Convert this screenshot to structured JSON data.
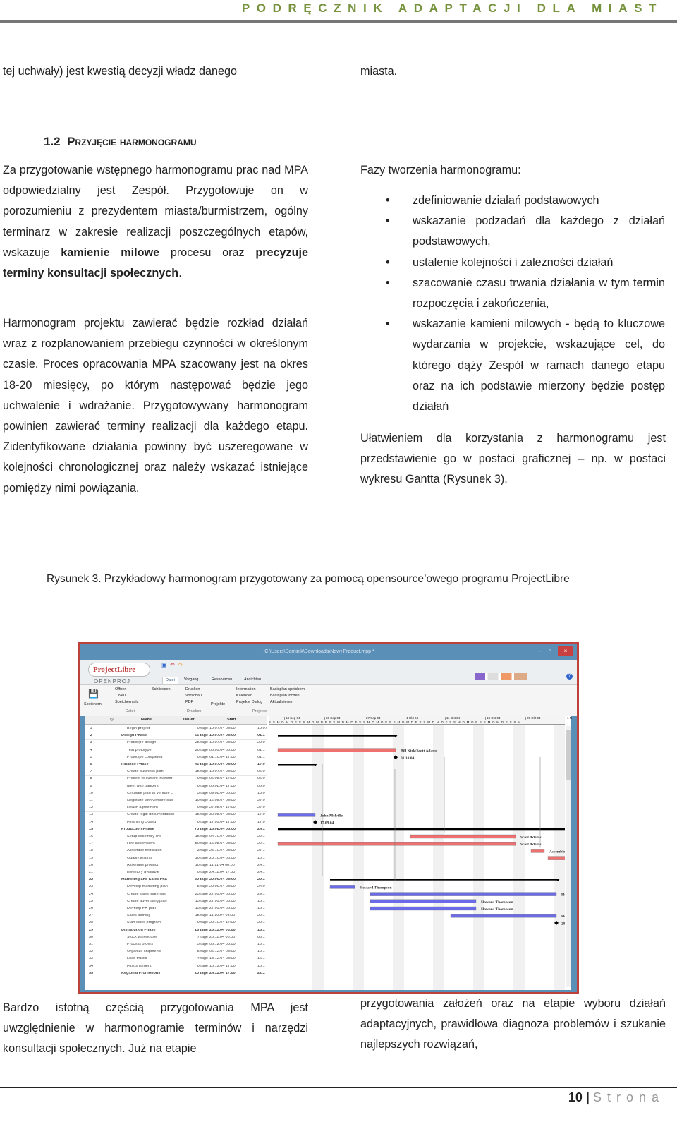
{
  "header": {
    "title": "PODRĘCZNIK ADAPTACJI DLA MIAST"
  },
  "top": {
    "left": "tej uchwały) jest kwestią decyzji władz danego",
    "right": "miasta."
  },
  "section": {
    "number": "1.2",
    "title": "Przyjęcie harmonogramu"
  },
  "left": {
    "p1_a": "Za przygotowanie wstępnego harmonogramu prac nad MPA odpowiedzialny jest Zespół. Przygotowuje on w porozumieniu z prezydentem miasta/burmistrzem, ogólny terminarz w zakresie realizacji poszczególnych etapów, wskazuje ",
    "p1_b": "kamienie milowe",
    "p1_c": " procesu oraz ",
    "p1_d": "precyzuje terminy konsultacji społecznych",
    "p1_e": ".",
    "p2": "Harmonogram projektu zawierać będzie rozkład działań wraz z rozplanowaniem przebiegu czynności w określonym czasie. Proces opracowania MPA szacowany jest na okres 18-20 miesięcy, po którym następować będzie jego uchwalenie i wdrażanie. Przygotowywany harmonogram powinien zawierać terminy realizacji dla każdego etapu. Zidentyfikowane działania powinny być uszeregowane w kolejności chronologicznej oraz należy wskazać istniejące pomiędzy nimi powiązania."
  },
  "right": {
    "intro": "Fazy tworzenia harmonogramu:",
    "bullets": [
      "zdefiniowanie działań podstawowych",
      "wskazanie podzadań dla każdego z działań podstawowych,",
      "ustalenie kolejności i zależności działań",
      "szacowanie czasu trwania działania w tym termin rozpoczęcia i zakończenia,",
      "wskazanie kamieni milowych - będą to kluczowe wydarzania w projekcie, wskazujące cel, do którego dąży Zespół w ramach danego etapu oraz na ich podstawie mierzony będzie postęp działań"
    ],
    "p": "Ułatwieniem dla korzystania z harmonogramu jest przedstawienie go w postaci graficznej – np. w postaci wykresu Gantta (Rysunek 3)."
  },
  "caption": "Rysunek 3. Przykładowy harmonogram przygotowany za pomocą opensource’owego programu ProjectLibre",
  "app": {
    "window_title": "- C:\\Users\\Dominik\\Downloads\\New+Product.mpp *",
    "logo": "ProjectLibre",
    "logo_sub": "OPENPROJ",
    "tabs": [
      "Datei",
      "Vorgang",
      "Ressourcen",
      "Ansichten"
    ],
    "ribbon": {
      "datei": {
        "save": "Speichern",
        "open": "Öffnen",
        "new": "Neu",
        "save_as": "Speichern als",
        "close": "Schliessen",
        "group": "Datei"
      },
      "drucken": {
        "print": "Drucken",
        "preview": "Vorschau",
        "pdf": "PDF",
        "group": "Drucken"
      },
      "projekte": {
        "projects": "Projekte",
        "info": "Information",
        "calendar": "Kalender",
        "dialog": "Projekte Dialog",
        "baseline_save": "Basisplan speichern",
        "baseline_delete": "Basisplan löchen",
        "update": "Aktualisieren",
        "group": "Projekte"
      }
    },
    "columns": [
      "Name",
      "Dauer",
      "Start"
    ],
    "weeks": [
      "13 Sep 04",
      "20 Sep 04",
      "27 Sep 04",
      "4 Okt 04",
      "11 Okt 04",
      "18 Okt 04",
      "25 Okt 04",
      "1 N"
    ],
    "days": "S S M D M D F S S M D M D F S S M D M D F S S M D M D F S S M D M D F S S M D M D F S S M D M D F S S M D M D F S S M",
    "rows": [
      [
        "1",
        "Begin project",
        "0 tage",
        "19.07.04 08:00",
        "19.07",
        false
      ],
      [
        "2",
        "Design Phase",
        "55 tage",
        "19.07.04 08:00",
        "01.1",
        true
      ],
      [
        "3",
        "Prototype design",
        "25 tage",
        "19.07.04 08:00",
        "20.0",
        false
      ],
      [
        "4",
        "Test prototype",
        "20 tage",
        "05.09.04 08:00",
        "01.1",
        false
      ],
      [
        "5",
        "Prototype completed",
        "0 tage",
        "01.10.04 17:00",
        "01.1",
        false
      ],
      [
        "6",
        "Finance Phase",
        "45 tage",
        "19.07.04 08:00",
        "17.0",
        true
      ],
      [
        "7",
        "Create business plan",
        "15 tage",
        "19.07.04 08:00",
        "06.0",
        false
      ],
      [
        "8",
        "Present to current investor",
        "0 tage",
        "06.08.04 17:00",
        "06.0",
        false
      ],
      [
        "9",
        "Meet with bankers",
        "0 tage",
        "06.08.04 17:00",
        "06.0",
        false
      ],
      [
        "10",
        "Circulate plan w/ venture c",
        "5 tage",
        "09.08.04 08:00",
        "13.0",
        false
      ],
      [
        "11",
        "Negotiate with venture cap",
        "10 tage",
        "16.08.04 08:00",
        "27.0",
        false
      ],
      [
        "12",
        "Reach agreement",
        "0 tage",
        "27.08.04 17:00",
        "27.0",
        false
      ],
      [
        "13",
        "Create legal documentation",
        "15 tage",
        "30.08.04 08:00",
        "17.0",
        false
      ],
      [
        "14",
        "Financing closed",
        "0 tage",
        "17.09.04 17:00",
        "17.0",
        false
      ],
      [
        "15",
        "Production Phase",
        "73 tage",
        "16.08.04 08:00",
        "24.1",
        true
      ],
      [
        "16",
        "Setup assembly line",
        "15 tage",
        "04.10.04 08:00",
        "22.1",
        false
      ],
      [
        "17",
        "Hire assemblers",
        "50 tage",
        "16.08.04 08:00",
        "22.1",
        false
      ],
      [
        "18",
        "Assemble first batch",
        "3 tage",
        "25.10.04 08:00",
        "27.1",
        false
      ],
      [
        "19",
        "Quality testing",
        "10 tage",
        "28.10.04 08:00",
        "10.1",
        false
      ],
      [
        "20",
        "Assemble product",
        "10 tage",
        "11.11.04 08:00",
        "24.1",
        false
      ],
      [
        "21",
        "Inventory available",
        "0 tage",
        "24.11.04 17:00",
        "24.1",
        false
      ],
      [
        "22",
        "Marketing and Sales Pha",
        "30 tage",
        "20.09.04 08:00",
        "29.1",
        true
      ],
      [
        "23",
        "Develop marketing plan",
        "5 tage",
        "20.09.04 08:00",
        "24.0",
        false
      ],
      [
        "24",
        "Create sales materials",
        "25 tage",
        "27.09.04 08:00",
        "29.1",
        false
      ],
      [
        "25",
        "Create advertising plan",
        "15 tage",
        "27.09.04 08:00",
        "15.1",
        false
      ],
      [
        "26",
        "Develop PR plan",
        "15 tage",
        "27.09.04 08:00",
        "15.1",
        false
      ],
      [
        "27",
        "Sales training",
        "15 tage",
        "11.10.04 08:00",
        "29.1",
        false
      ],
      [
        "28",
        "Start sales program",
        "0 tage",
        "29.10.04 17:00",
        "29.1",
        false
      ],
      [
        "29",
        "Distribution Phase",
        "16 tage",
        "25.11.04 08:00",
        "16.1",
        true
      ],
      [
        "30",
        "Stock warehouse",
        "7 tage",
        "25.11.04 08:00",
        "03.1",
        false
      ],
      [
        "31",
        "Process orders",
        "5 tage",
        "06.12.04 08:00",
        "10.1",
        false
      ],
      [
        "32",
        "Organize shipments",
        "5 tage",
        "06.12.04 08:00",
        "10.1",
        false
      ],
      [
        "33",
        "Load trucks",
        "4 tage",
        "13.12.04 08:00",
        "16.1",
        false
      ],
      [
        "34",
        "First shipment",
        "0 tage",
        "16.12.04 17:00",
        "16.1",
        false
      ],
      [
        "35",
        "Regional Promotions",
        "20 tage",
        "24.11.04 17:00",
        "22.1",
        true
      ]
    ],
    "bar_labels": {
      "r4": "Bill Kirk/Scott Adams",
      "r5": "01.10.04",
      "r13": "John Melville",
      "r14": "17.09.04",
      "r16": "Scott Adams",
      "r17": "Scott Adams",
      "r18": "Assemblers",
      "r23": "Howard Thompson",
      "r24": "Howard",
      "r25": "Howard Thompson",
      "r26": "Howard Thompson",
      "r27": "Howard",
      "r28": "29.10.0"
    },
    "colors": {
      "task_red": "#f07070",
      "task_blue": "#6b6be8",
      "summary": "#000000",
      "frame": "#c0403a",
      "titlebar": "#5a8fb8"
    }
  },
  "bottom": {
    "left": "Bardzo istotną częścią przygotowania MPA jest uwzględnienie w harmonogramie terminów i narzędzi konsultacji społecznych. Już na etapie",
    "right": "przygotowania założeń oraz na etapie wyboru działań adaptacyjnych, prawidłowa diagnoza problemów i szukanie najlepszych rozwiązań,"
  },
  "footer": {
    "page": "10",
    "sep": "|",
    "label": "Strona"
  }
}
